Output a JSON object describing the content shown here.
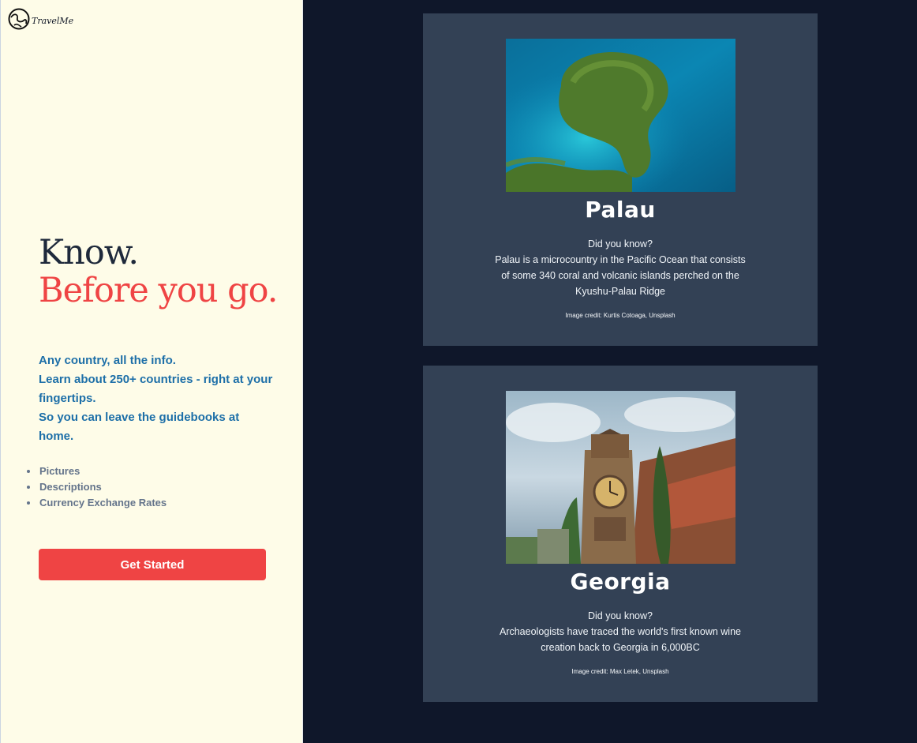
{
  "brand": {
    "name": "TravelMe",
    "logo_icon": "globe-logo-icon"
  },
  "hero": {
    "line1": "Know.",
    "line2": "Before you go."
  },
  "pitch": {
    "line1": "Any country, all the info.",
    "line2": "Learn about 250+ countries - right at your fingertips.",
    "line3": "So you can leave the guidebooks at home."
  },
  "features": [
    "Pictures",
    "Descriptions",
    "Currency Exchange Rates"
  ],
  "cta": {
    "label": "Get Started"
  },
  "cards": [
    {
      "country": "Palau",
      "fact_heading": "Did you know?",
      "fact_body": "Palau is a microcountry in the Pacific Ocean that consists of some 340 coral and volcanic islands perched on the Kyushu-Palau Ridge",
      "credit": "Image credit: Kurtis Cotoaga, Unsplash"
    },
    {
      "country": "Georgia",
      "fact_heading": "Did you know?",
      "fact_body": "Archaeologists have traced the world's first known wine creation back to Georgia in 6,000BC",
      "credit": "Image credit: Max Letek, Unsplash"
    }
  ],
  "colors": {
    "left_bg": "#fefce8",
    "right_bg": "#0f172a",
    "card_bg": "#334155",
    "accent_red": "#ef4444",
    "pitch_blue": "#1d6fa8",
    "hero_dark": "#1e293b"
  }
}
